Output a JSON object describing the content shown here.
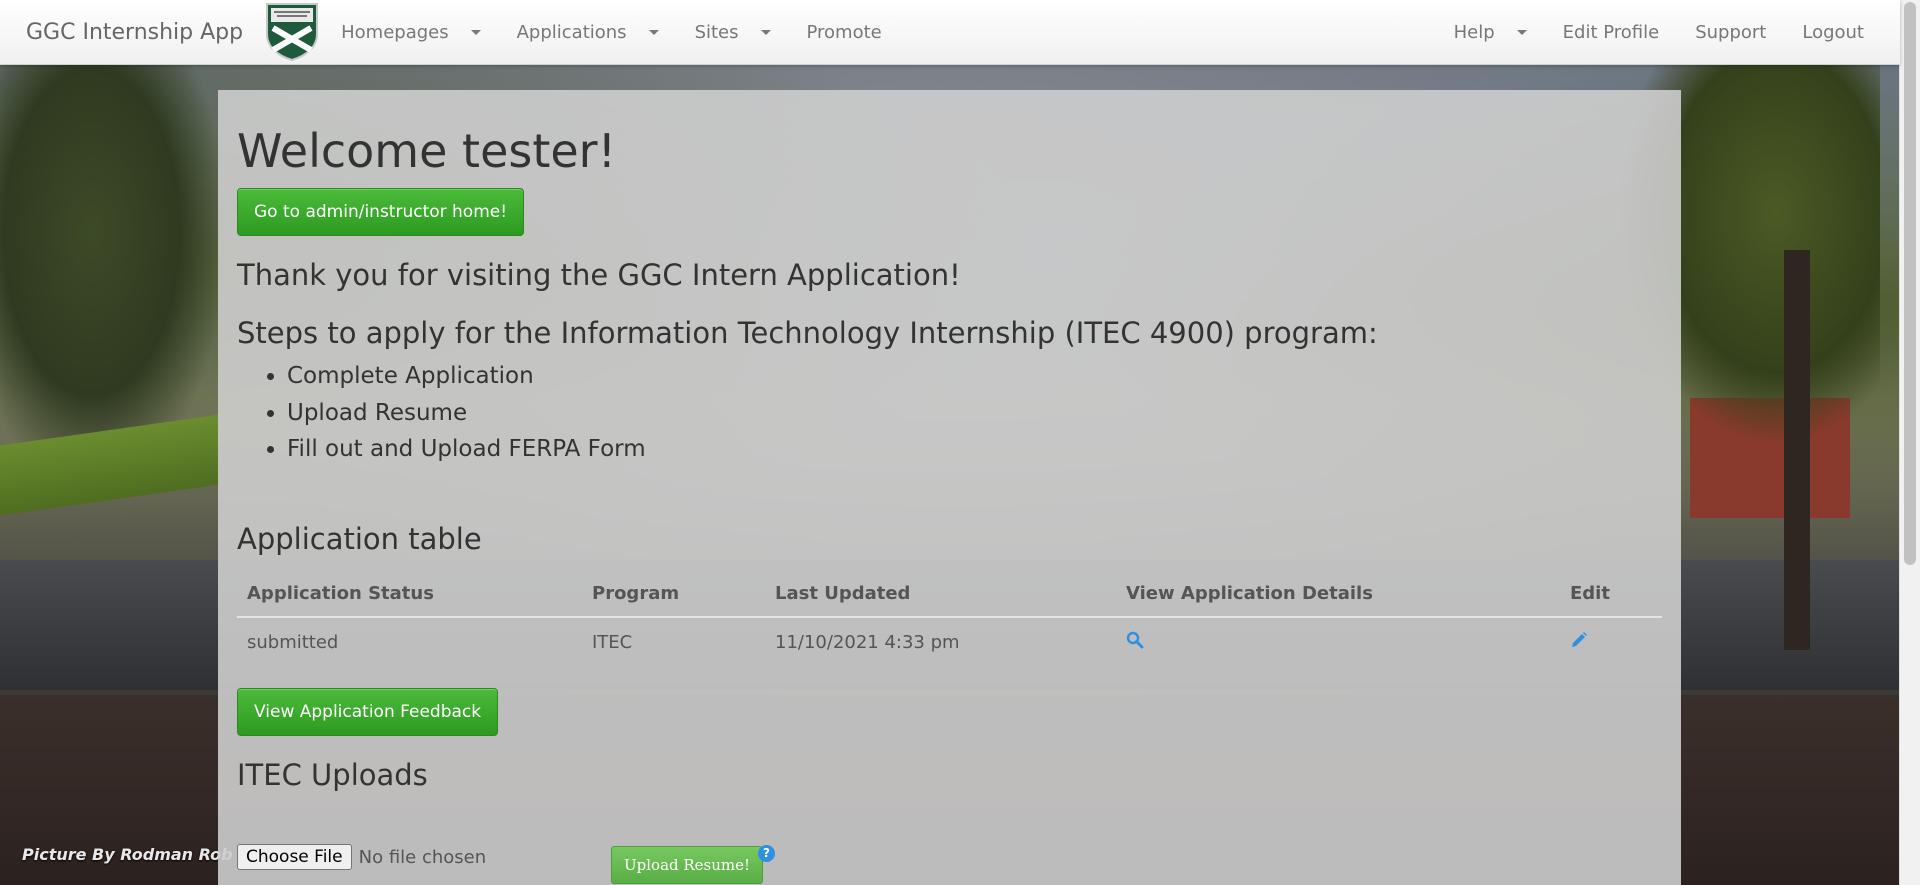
{
  "navbar": {
    "brand": "GGC Internship App",
    "logo_icon": "ggc-crest-icon",
    "left_items": [
      {
        "label": "Homepages",
        "has_dropdown": true
      },
      {
        "label": "Applications",
        "has_dropdown": true
      },
      {
        "label": "Sites",
        "has_dropdown": true
      },
      {
        "label": "Promote",
        "has_dropdown": false
      }
    ],
    "right_items": [
      {
        "label": "Help",
        "has_dropdown": true
      },
      {
        "label": "Edit Profile",
        "has_dropdown": false
      },
      {
        "label": "Support",
        "has_dropdown": false
      },
      {
        "label": "Logout",
        "has_dropdown": false
      }
    ]
  },
  "main": {
    "welcome": "Welcome tester!",
    "admin_button": "Go to admin/instructor home!",
    "thanks": "Thank you for visiting the GGC Intern Application!",
    "steps_heading": "Steps to apply for the Information Technology Internship (ITEC 4900) program:",
    "steps": [
      "Complete Application",
      "Upload Resume",
      "Fill out and Upload FERPA Form"
    ],
    "table_heading": "Application table",
    "table": {
      "headers": [
        "Application Status",
        "Program",
        "Last Updated",
        "View Application Details",
        "Edit"
      ],
      "rows": [
        {
          "status": "submitted",
          "program": "ITEC",
          "last_updated": "11/10/2021 4:33 pm",
          "view_icon": "search-icon",
          "edit_icon": "pencil-icon"
        }
      ]
    },
    "feedback_button": "View Application Feedback",
    "uploads_heading": "ITEC Uploads",
    "file_input": {
      "button": "Choose File",
      "status": "No file chosen"
    },
    "upload_button": "Upload Resume!",
    "help_icon": "?"
  },
  "photo_credit": "Picture By Rodman Rob",
  "colors": {
    "accent_green": "#2c9a21",
    "icon_blue": "#2f8fe0",
    "panel_bg": "#cdcdcd"
  }
}
